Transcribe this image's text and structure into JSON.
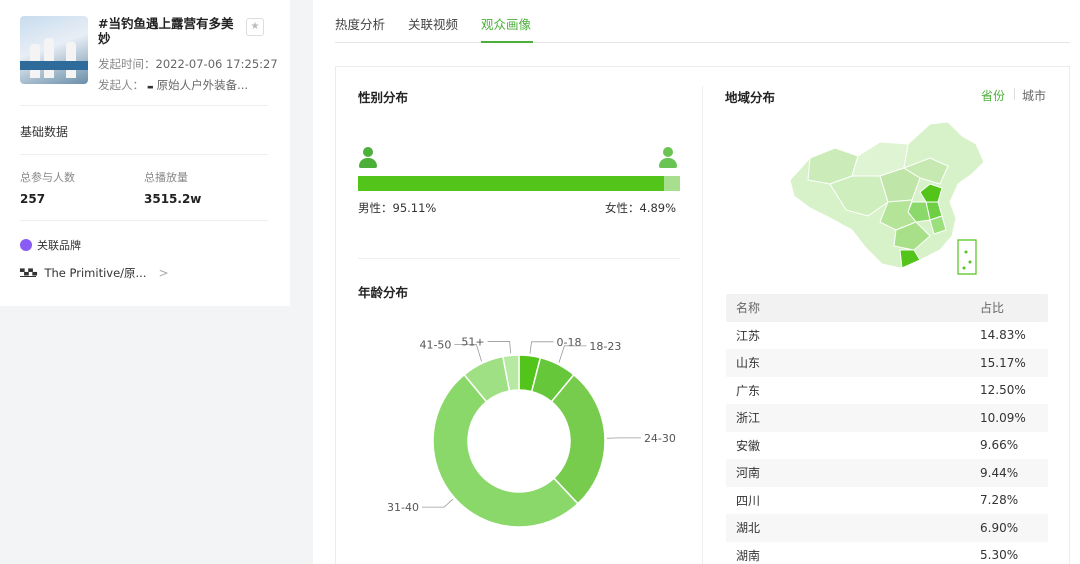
{
  "video": {
    "title": "#当钓鱼遇上露营有多美妙",
    "launch_label": "发起时间：",
    "launch_time": "2022-07-06 17:25:27",
    "initiator_label": "发起人：",
    "initiator": "原始人户外装备..."
  },
  "basic": {
    "section_label": "基础数据",
    "participants_label": "总参与人数",
    "participants_value": "257",
    "plays_label": "总播放量",
    "plays_value": "3515.2w"
  },
  "brand": {
    "section_label": "关联品牌",
    "name": "The Primitive/原..."
  },
  "tabs": [
    {
      "label": "热度分析"
    },
    {
      "label": "关联视频"
    },
    {
      "label": "观众画像"
    }
  ],
  "gender": {
    "title": "性别分布",
    "male_label": "男性：",
    "male_value": "95.11%",
    "female_label": "女性：",
    "female_value": "4.89%",
    "male_color": "#52c41a",
    "female_color": "#a8df8e"
  },
  "age": {
    "title": "年龄分布"
  },
  "region": {
    "title": "地域分布",
    "seg_province": "省份",
    "seg_city": "城市",
    "col_name": "名称",
    "col_ratio": "占比",
    "rows": [
      {
        "name": "江苏",
        "ratio": "14.83%"
      },
      {
        "name": "山东",
        "ratio": "15.17%"
      },
      {
        "name": "广东",
        "ratio": "12.50%"
      },
      {
        "name": "浙江",
        "ratio": "10.09%"
      },
      {
        "name": "安徽",
        "ratio": "9.66%"
      },
      {
        "name": "河南",
        "ratio": "9.44%"
      },
      {
        "name": "四川",
        "ratio": "7.28%"
      },
      {
        "name": "湖北",
        "ratio": "6.90%"
      },
      {
        "name": "湖南",
        "ratio": "5.30%"
      }
    ]
  },
  "chart_data": {
    "type": "pie",
    "categories": [
      "0-18",
      "18-23",
      "24-30",
      "31-40",
      "41-50",
      "51+"
    ],
    "values": [
      4,
      7,
      27,
      51,
      8,
      3
    ],
    "colors": [
      "#52c41a",
      "#66c73a",
      "#77cc4e",
      "#8ad86a",
      "#9fe085",
      "#b6e9a1"
    ]
  }
}
